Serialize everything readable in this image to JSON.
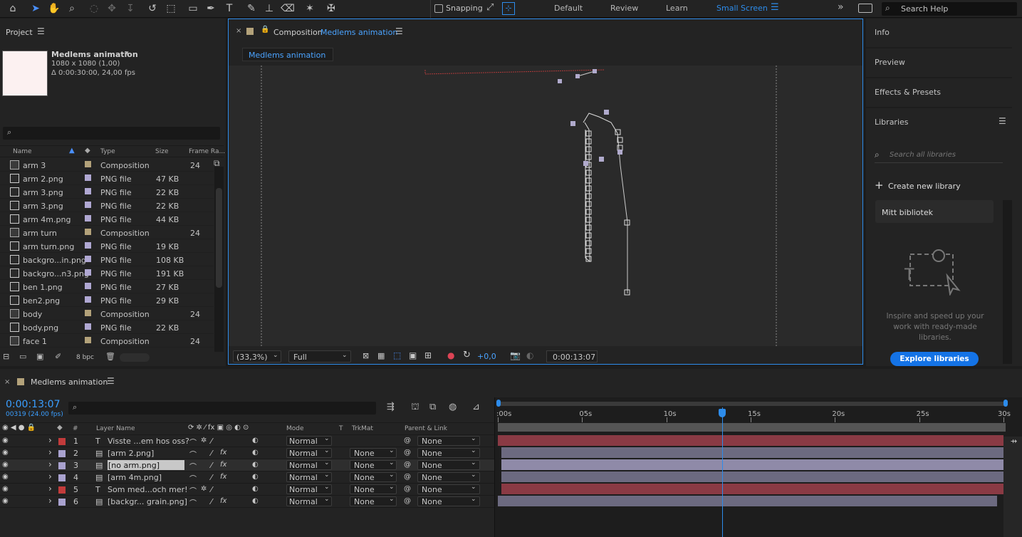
{
  "toolbar": {
    "snapping_label": "Snapping",
    "workspaces": [
      "Default",
      "Review",
      "Learn",
      "Small Screen"
    ],
    "active_workspace": "Small Screen",
    "search_help_placeholder": "Search Help",
    "icons": [
      "home-icon",
      "selection-tool-icon",
      "hand-tool-icon",
      "zoom-tool-icon",
      "orbit-camera-icon",
      "pan-camera-icon",
      "dolly-camera-icon",
      "rotation-tool-icon",
      "pan-behind-icon",
      "rectangle-tool-icon",
      "pen-tool-icon",
      "type-tool-icon",
      "brush-tool-icon",
      "clone-stamp-icon",
      "eraser-icon",
      "roto-brush-icon",
      "puppet-pin-icon"
    ]
  },
  "project": {
    "title": "Project",
    "comp_name": "Medlems animation",
    "comp_size": "1080 x 1080 (1,00)",
    "comp_duration": "Δ 0:00:30:00, 24,00 fps",
    "columns": [
      "Name",
      "Type",
      "Size",
      "Frame Ra..."
    ],
    "items": [
      {
        "name": "arm 3",
        "type": "Composition",
        "size": "",
        "fps": "24",
        "kind": "comp"
      },
      {
        "name": "arm 2.png",
        "type": "PNG file",
        "size": "47 KB",
        "fps": "",
        "kind": "png"
      },
      {
        "name": "arm 3.png",
        "type": "PNG file",
        "size": "22 KB",
        "fps": "",
        "kind": "png"
      },
      {
        "name": "arm 3.png",
        "type": "PNG file",
        "size": "22 KB",
        "fps": "",
        "kind": "png"
      },
      {
        "name": "arm 4m.png",
        "type": "PNG file",
        "size": "44 KB",
        "fps": "",
        "kind": "png"
      },
      {
        "name": "arm turn",
        "type": "Composition",
        "size": "",
        "fps": "24",
        "kind": "comp"
      },
      {
        "name": "arm turn.png",
        "type": "PNG file",
        "size": "19 KB",
        "fps": "",
        "kind": "png"
      },
      {
        "name": "backgro...in.png",
        "type": "PNG file",
        "size": "108 KB",
        "fps": "",
        "kind": "png"
      },
      {
        "name": "backgro...n3.png",
        "type": "PNG file",
        "size": "191 KB",
        "fps": "",
        "kind": "png"
      },
      {
        "name": "ben 1.png",
        "type": "PNG file",
        "size": "27 KB",
        "fps": "",
        "kind": "png"
      },
      {
        "name": "ben2.png",
        "type": "PNG file",
        "size": "29 KB",
        "fps": "",
        "kind": "png"
      },
      {
        "name": "body",
        "type": "Composition",
        "size": "",
        "fps": "24",
        "kind": "comp"
      },
      {
        "name": "body.png",
        "type": "PNG file",
        "size": "22 KB",
        "fps": "",
        "kind": "png"
      },
      {
        "name": "face 1",
        "type": "Composition",
        "size": "",
        "fps": "24",
        "kind": "comp"
      }
    ],
    "bpc": "8 bpc",
    "colors": {
      "comp_swatch": "#b3a27a",
      "png_swatch": "#b0a8d3"
    }
  },
  "composition": {
    "title_prefix": "Composition",
    "title_name": "Medlems animation",
    "tab_label": "Medlems animation",
    "zoom": "(33,3%)",
    "resolution": "Full",
    "exposure": "+0,0",
    "timecode": "0:00:13:07"
  },
  "right_panel": {
    "items": [
      "Info",
      "Preview",
      "Effects & Presets",
      "Libraries"
    ],
    "libraries_search_placeholder": "Search all libraries",
    "create_library": "Create new library",
    "my_library": "Mitt bibliotek",
    "inspire_text": "Inspire and speed up your work with ready-made libraries.",
    "explore_button": "Explore libraries"
  },
  "timeline": {
    "comp_name": "Medlems animation",
    "timecode": "0:00:13:07",
    "frame_info": "00319 (24.00 fps)",
    "columns": {
      "num": "#",
      "layer_name": "Layer Name",
      "mode": "Mode",
      "t": "T",
      "trkmat": "TrkMat",
      "parent": "Parent & Link"
    },
    "ruler": [
      "0s",
      "05s",
      "10s",
      "15s",
      "20s",
      "25s",
      "30s"
    ],
    "ruler_label_0": ":00s",
    "duration_seconds": 30,
    "current_time_seconds": 13.29,
    "layers": [
      {
        "num": "1",
        "name": "Visste ...em hos oss?",
        "kind": "text",
        "color": "#c23b3b",
        "mode": "Normal",
        "trkmat": "",
        "parent": "None",
        "bar_color": "#8a3a44",
        "start": 0,
        "end": 30
      },
      {
        "num": "2",
        "name": "[arm 2.png]",
        "kind": "footage",
        "color": "#a9a2cf",
        "mode": "Normal",
        "trkmat": "None",
        "parent": "None",
        "bar_color": "#6c6a80",
        "start": 0.2,
        "end": 30
      },
      {
        "num": "3",
        "name": "[no arm.png]",
        "kind": "footage",
        "color": "#a9a2cf",
        "mode": "Normal",
        "trkmat": "None",
        "parent": "None",
        "bar_color": "#8f8aa8",
        "start": 0.2,
        "end": 30
      },
      {
        "num": "4",
        "name": "[arm 4m.png]",
        "kind": "footage",
        "color": "#a9a2cf",
        "mode": "Normal",
        "trkmat": "None",
        "parent": "None",
        "bar_color": "#6c6a80",
        "start": 0.2,
        "end": 30
      },
      {
        "num": "5",
        "name": "Som med...och mer!",
        "kind": "text",
        "color": "#c23b3b",
        "mode": "Normal",
        "trkmat": "None",
        "parent": "None",
        "bar_color": "#8a3a44",
        "start": 0.2,
        "end": 30
      },
      {
        "num": "6",
        "name": "[backgr... grain.png]",
        "kind": "footage",
        "color": "#a9a2cf",
        "mode": "Normal",
        "trkmat": "None",
        "parent": "None",
        "bar_color": "#6c6a80",
        "start": 0,
        "end": 29.6
      }
    ],
    "selected_layer": "3"
  }
}
